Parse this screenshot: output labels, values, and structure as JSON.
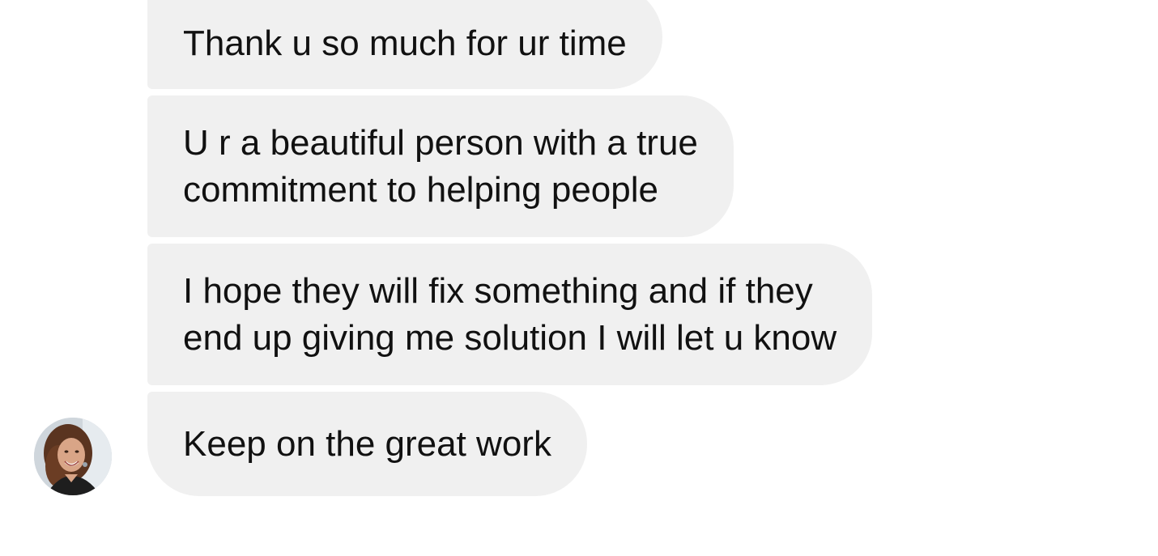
{
  "thread": {
    "messages": [
      {
        "lines": [
          "Thank u so much for ur time"
        ]
      },
      {
        "lines": [
          "U r a beautiful person with a true",
          "commitment to helping people"
        ]
      },
      {
        "lines": [
          "I hope they will fix something and if they",
          "end up giving me solution I will let u know"
        ]
      },
      {
        "lines": [
          "Keep on the great work"
        ]
      }
    ],
    "sender": {
      "avatar_icon": "profile-photo"
    }
  },
  "colors": {
    "bubble_background": "#f0f0f0",
    "text": "#111111",
    "page_background": "#ffffff"
  }
}
